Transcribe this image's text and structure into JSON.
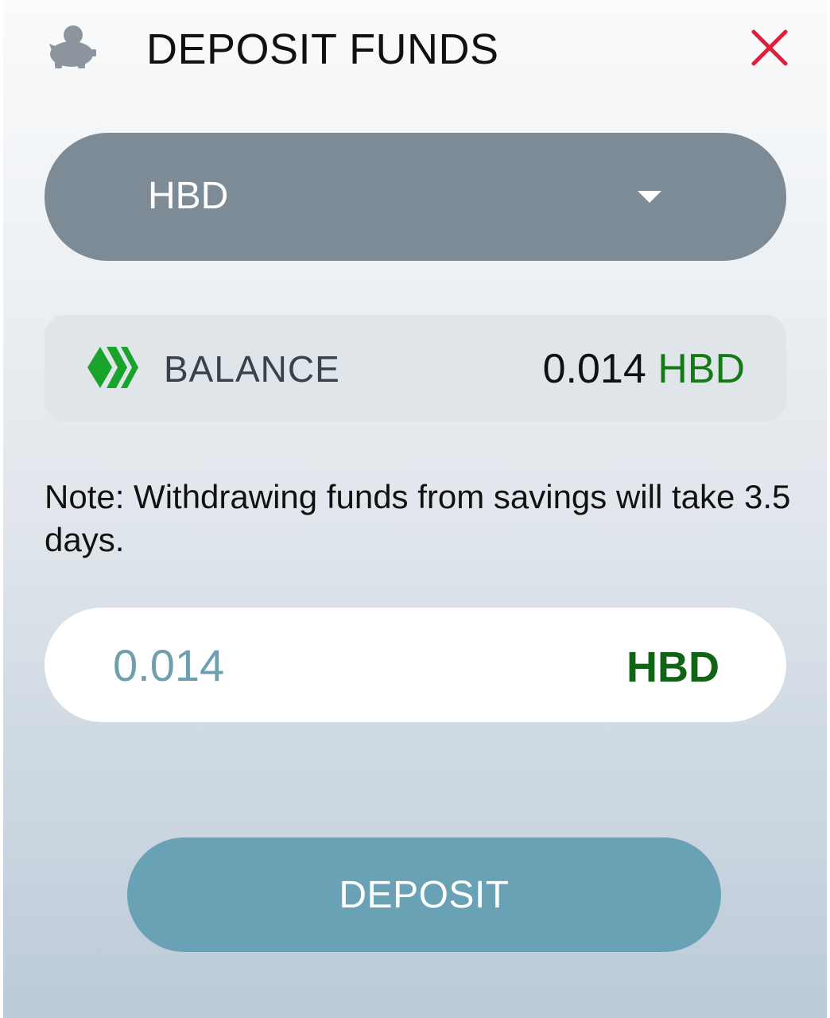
{
  "header": {
    "title": "DEPOSIT FUNDS",
    "icon": "piggy-bank-icon",
    "close_icon": "close-icon",
    "close_color": "#e0203b"
  },
  "currency_select": {
    "selected": "HBD",
    "icon": "caret-down-icon"
  },
  "balance": {
    "icon": "hive-logo-icon",
    "label": "BALANCE",
    "amount": "0.014",
    "currency": "HBD"
  },
  "note": "Note: Withdrawing funds from savings will take 3.5 days.",
  "amount_field": {
    "value": "0.014",
    "currency": "HBD"
  },
  "deposit_button": {
    "label": "DEPOSIT"
  },
  "colors": {
    "accent_green": "#137a16",
    "dropdown_bg": "#7d8b97",
    "button_bg": "#68a2b4"
  }
}
